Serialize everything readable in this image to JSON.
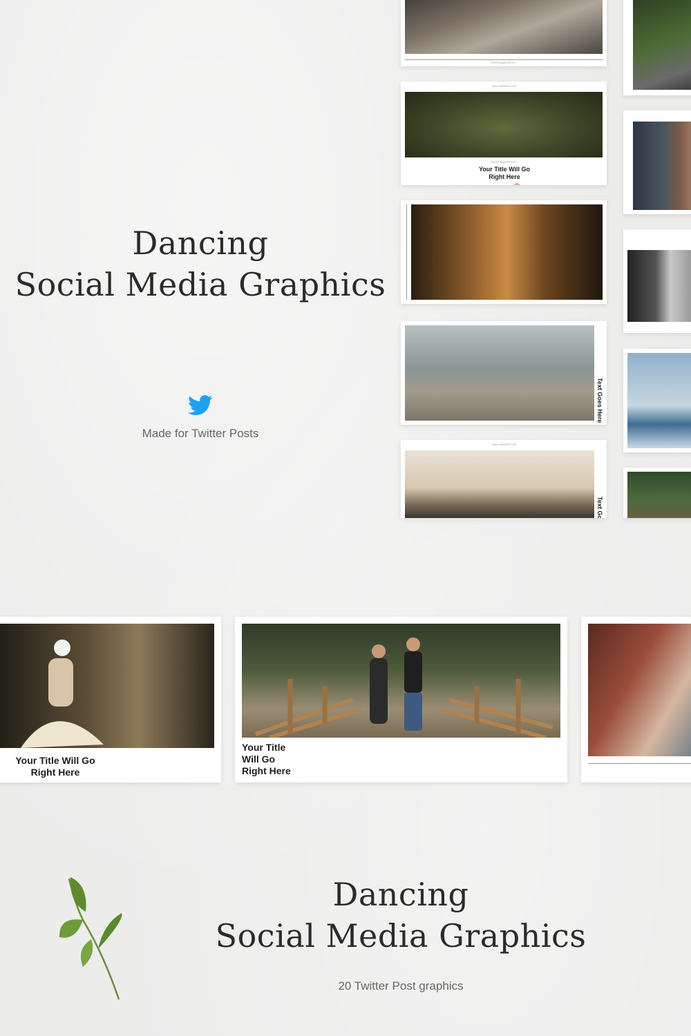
{
  "hero": {
    "title_line1": "Dancing",
    "title_line2": "Social Media Graphics",
    "subtitle": "Made for Twitter Posts",
    "icon": "twitter-bird-icon"
  },
  "cards": {
    "caption_line1": "Your Title Will Go",
    "caption_line2": "Right Here",
    "large_caption_line1": "Your Title",
    "large_caption_line2": "Will Go",
    "large_caption_line3": "Right Here",
    "side_text": "Text Goes Here",
    "side_text_clipped": "Text Go",
    "handle": "/hashtaggoeshere",
    "url": "www.website.com"
  },
  "footer": {
    "title_line1": "Dancing",
    "title_line2": "Social Media Graphics",
    "count_text": "20 Twitter Post graphics",
    "icon": "leaf-sprig-icon"
  },
  "colors": {
    "background": "#ececeb",
    "twitter_blue": "#1da1f2",
    "text_dark": "#2b2b2b"
  }
}
